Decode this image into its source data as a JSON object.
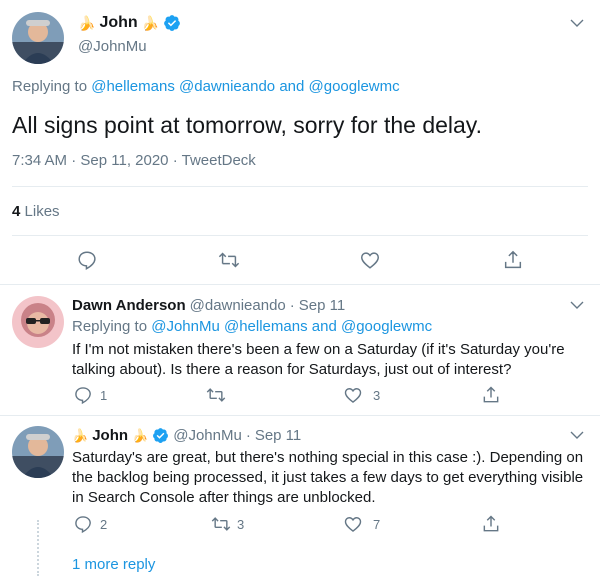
{
  "main_tweet": {
    "name": "John",
    "name_emoji": "🍌",
    "handle": "@JohnMu",
    "replying_label": "Replying to",
    "replying_to": [
      "@hellemans",
      "@dawnieando",
      "@googlewmc"
    ],
    "and_label": "and",
    "text": "All signs point at tomorrow, sorry for the delay.",
    "time": "7:34 AM",
    "date": "Sep 11, 2020",
    "source": "TweetDeck",
    "likes_count": "4",
    "likes_label": "Likes",
    "icons": [
      "reply-icon",
      "retweet-icon",
      "like-icon",
      "share-icon"
    ]
  },
  "replies": [
    {
      "name": "Dawn Anderson",
      "handle": "@dawnieando",
      "date": "Sep 11",
      "replying_label": "Replying to",
      "replying_to": [
        "@JohnMu",
        "@hellemans",
        "@googlewmc"
      ],
      "and_label": "and",
      "text": "If I'm not mistaken there's been a few on a Saturday (if it's Saturday you're talking about). Is there a reason for Saturdays, just out of interest?",
      "reply_count": "1",
      "retweet_count": "",
      "like_count": "3"
    },
    {
      "name": "John",
      "name_emoji": "🍌",
      "handle": "@JohnMu",
      "date": "Sep 11",
      "text": "Saturday's are great, but there's nothing special in this case :). Depending on the backlog being processed, it just takes a few days to get everything visible in Search Console after things are unblocked.",
      "reply_count": "2",
      "retweet_count": "3",
      "like_count": "7"
    }
  ],
  "more_replies": "1 more reply",
  "separator": "·",
  "colors": {
    "link": "#1b95e0",
    "muted": "#657786",
    "text": "#14171a",
    "verified": "#1da1f2",
    "divider": "#e6ecf0"
  }
}
